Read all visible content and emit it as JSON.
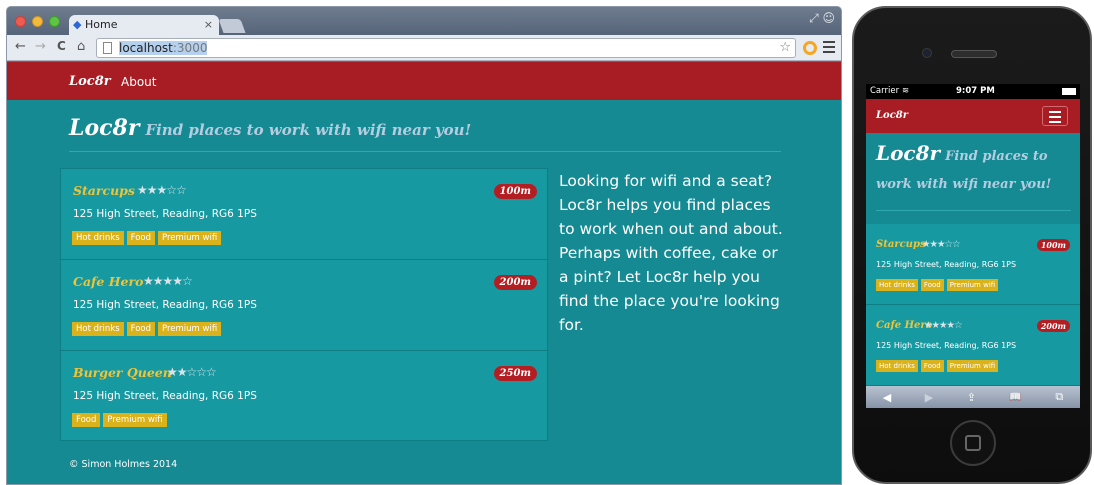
{
  "browser": {
    "tab_title": "Home",
    "tab_close": "×",
    "nav_back": "←",
    "nav_forward": "→",
    "reload": "C",
    "home": "⌂",
    "url_host": "localhost",
    "url_port": ":3000",
    "bookmark_star": "☆"
  },
  "site": {
    "brand": "Loc8r",
    "nav_about": "About",
    "logo": "Loc8r",
    "tagline": "Find places to work with wifi near you!",
    "sidebar_text": "Looking for wifi and a seat? Loc8r helps you find places to work when out and about. Perhaps with coffee, cake or a pint? Let Loc8r help you find the place you're looking for.",
    "footer": "© Simon Holmes 2014",
    "accent_red": "#a81c23",
    "teal": "#158a93",
    "gold": "#f0c436"
  },
  "locations": [
    {
      "name": "Starcups",
      "rating": 3,
      "rating_display": "★★★☆☆",
      "address": "125 High Street, Reading, RG6 1PS",
      "distance": "100m",
      "facilities": [
        "Hot drinks",
        "Food",
        "Premium wifi"
      ]
    },
    {
      "name": "Cafe Hero",
      "rating": 4,
      "rating_display": "★★★★☆",
      "address": "125 High Street, Reading, RG6 1PS",
      "distance": "200m",
      "facilities": [
        "Hot drinks",
        "Food",
        "Premium wifi"
      ]
    },
    {
      "name": "Burger Queen",
      "rating": 2,
      "rating_display": "★★☆☆☆",
      "address": "125 High Street, Reading, RG6 1PS",
      "distance": "250m",
      "facilities": [
        "Food",
        "Premium wifi"
      ]
    }
  ],
  "phone": {
    "carrier": "Carrier",
    "time": "9:07 PM",
    "brand": "Loc8r",
    "logo": "Loc8r",
    "tagline": "Find places to work with wifi near you!",
    "toolbar": {
      "back": "◀",
      "forward": "▶",
      "share": "⇪",
      "bookmarks": "📖",
      "tabs": "⧉"
    }
  }
}
